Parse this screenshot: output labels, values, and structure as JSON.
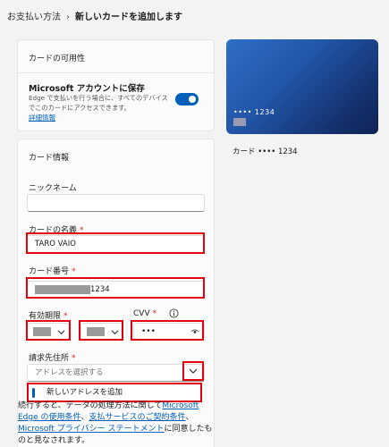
{
  "breadcrumb": {
    "parent": "お支払い方法",
    "separator": "›",
    "current": "新しいカードを追加します"
  },
  "availability": {
    "title": "カードの可用性",
    "save_label": "Microsoft アカウントに保存",
    "save_desc": "Edge で支払いを行う場合に、すべてのデバイスでこのカードにアクセスできます。",
    "details_link": "詳細情報",
    "toggle_on": true
  },
  "card_info": {
    "title": "カード情報",
    "nickname_label": "ニックネーム",
    "nickname_value": "",
    "name_label": "カードの名義",
    "name_value": "TARO VAIO",
    "number_label": "カード番号",
    "number_suffix": "1234",
    "expiry_label": "有効期限",
    "cvv_label": "CVV",
    "cvv_value": "•••",
    "billing_label": "請求先住所",
    "billing_placeholder": "アドレスを選択する",
    "required_mark": "*",
    "dropdown_option": "新しいアドレスを追加"
  },
  "terms": {
    "t1": "続行すると、データの処理方法に関して",
    "link1": "Microsoft Edge の使用条件",
    "t2": "、",
    "link2": "支払サービスのご契約条件",
    "t3": "、",
    "link3": "Microsoft プライバシー ステートメント",
    "t4": "に同意したものと見なされます。"
  },
  "card_preview": {
    "number_masked": "•••• 1234",
    "caption": "カード •••• 1234"
  },
  "colors": {
    "accent": "#005fb8",
    "highlight_red": "#e3000f"
  }
}
